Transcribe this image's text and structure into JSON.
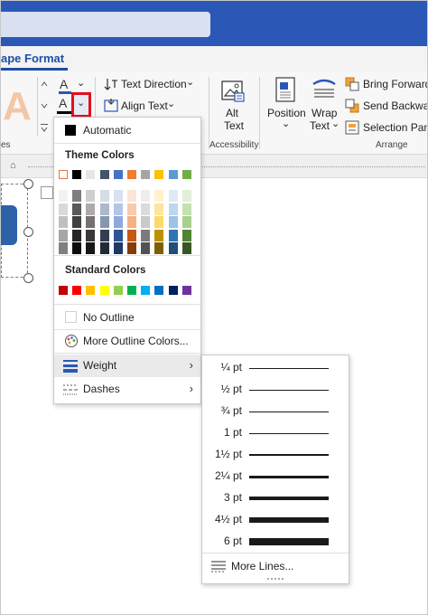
{
  "ribbon": {
    "active_tab": "ape Format",
    "text_direction": "Text Direction",
    "align_text": "Align Text",
    "alt_text_line1": "Alt",
    "alt_text_line2": "Text",
    "position": "Position",
    "wrap_line1": "Wrap",
    "wrap_line2": "Text",
    "bring_forward": "Bring Forward",
    "send_backward": "Send Backward",
    "selection_pane": "Selection Pane",
    "group_accessibility": "Accessibility",
    "group_arrange": "Arrange",
    "group_partial": "es",
    "wordart_letter": "A",
    "font_color_letter": "A",
    "outline_letter": "A"
  },
  "outline_menu": {
    "automatic": "Automatic",
    "theme_colors_heading": "Theme Colors",
    "standard_colors_heading": "Standard Colors",
    "no_outline": "No Outline",
    "more_outline_colors": "More Outline Colors...",
    "weight": "Weight",
    "dashes": "Dashes",
    "theme_top_row": [
      "#ffffff",
      "#000000",
      "#e7e6e6",
      "#44546a",
      "#4472c4",
      "#ed7d31",
      "#a5a5a5",
      "#ffc000",
      "#5b9bd5",
      "#70ad47"
    ],
    "theme_shade_columns": [
      [
        "#f2f2f2",
        "#d9d9d9",
        "#bfbfbf",
        "#a6a6a6",
        "#808080"
      ],
      [
        "#7f7f7f",
        "#595959",
        "#404040",
        "#262626",
        "#0d0d0d"
      ],
      [
        "#d0cece",
        "#aeaaaa",
        "#767171",
        "#3b3838",
        "#181717"
      ],
      [
        "#d6dce4",
        "#acb9ca",
        "#8497b0",
        "#333f50",
        "#222a35"
      ],
      [
        "#d9e2f3",
        "#b4c6e7",
        "#8eaadb",
        "#2f5496",
        "#1f3864"
      ],
      [
        "#fbe5d5",
        "#f7cbac",
        "#f4b183",
        "#c55a11",
        "#833c0b"
      ],
      [
        "#ededed",
        "#dbdbdb",
        "#c9c9c9",
        "#7b7b7b",
        "#525252"
      ],
      [
        "#fff2cc",
        "#fee599",
        "#ffd966",
        "#bf9000",
        "#7f6000"
      ],
      [
        "#deebf6",
        "#bdd7ee",
        "#9dc3e6",
        "#2e75b5",
        "#1f4e79"
      ],
      [
        "#e2efd9",
        "#c5e0b3",
        "#a8d08d",
        "#538135",
        "#375623"
      ]
    ],
    "standard_colors": [
      "#c00000",
      "#ff0000",
      "#ffc000",
      "#ffff00",
      "#92d050",
      "#00b050",
      "#00b0f0",
      "#0070c0",
      "#002060",
      "#7030a0"
    ]
  },
  "weight_menu": {
    "items": [
      {
        "label": "¼ pt",
        "weight": 0.25
      },
      {
        "label": "½ pt",
        "weight": 0.5
      },
      {
        "label": "¾ pt",
        "weight": 0.75
      },
      {
        "label": "1 pt",
        "weight": 1
      },
      {
        "label": "1½ pt",
        "weight": 1.5
      },
      {
        "label": "2¼ pt",
        "weight": 2.25
      },
      {
        "label": "3 pt",
        "weight": 3
      },
      {
        "label": "4½ pt",
        "weight": 4.5
      },
      {
        "label": "6 pt",
        "weight": 6
      }
    ],
    "more_lines": "More Lines..."
  }
}
